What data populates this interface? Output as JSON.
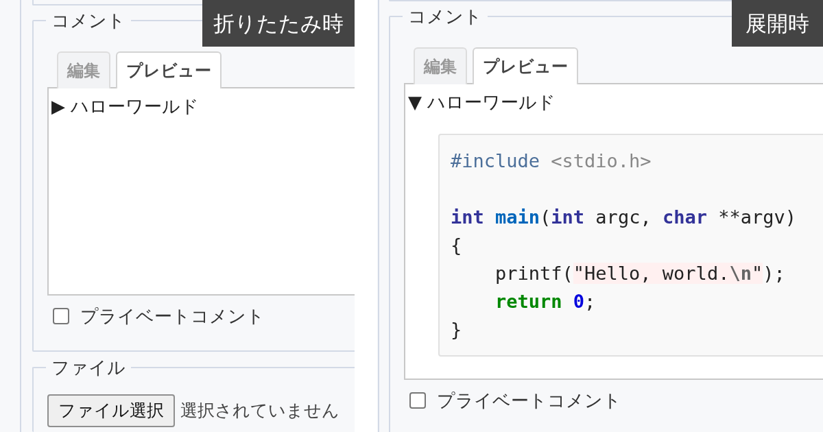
{
  "panels": [
    {
      "badge": "折りたたみ時",
      "legend": "コメント",
      "tabs": [
        {
          "label": "編集",
          "selected": false
        },
        {
          "label": "プレビュー",
          "selected": true
        }
      ],
      "details": {
        "expanded": false,
        "marker": "▶",
        "summary": "ハローワールド"
      },
      "checkbox": {
        "label": "プライベートコメント",
        "checked": false
      },
      "file_section": {
        "legend": "ファイル",
        "button": "ファイル選択",
        "status": "選択されていません"
      }
    },
    {
      "badge": "展開時",
      "legend": "コメント",
      "tabs": [
        {
          "label": "編集",
          "selected": false
        },
        {
          "label": "プレビュー",
          "selected": true
        }
      ],
      "details": {
        "expanded": true,
        "marker": "▼",
        "summary": "ハローワールド",
        "code": [
          {
            "kind": "code",
            "tokens": [
              {
                "text": "#include",
                "kind": "preproc"
              },
              {
                "text": " <stdio.h>",
                "kind": "header"
              }
            ]
          },
          {
            "kind": "blank"
          },
          {
            "kind": "code",
            "tokens": [
              {
                "text": "int",
                "kind": "keyword"
              },
              {
                "text": " main",
                "kind": "func"
              },
              {
                "text": "(",
                "kind": "plain"
              },
              {
                "text": "int",
                "kind": "keyword"
              },
              {
                "text": " argc, ",
                "kind": "plain"
              },
              {
                "text": "char",
                "kind": "keyword"
              },
              {
                "text": " **argv)",
                "kind": "plain"
              }
            ]
          },
          {
            "kind": "code",
            "tokens": [
              {
                "text": "{",
                "kind": "plain"
              }
            ]
          },
          {
            "kind": "code",
            "tokens": [
              {
                "text": "    printf(",
                "kind": "plain"
              },
              {
                "text": "\"Hello, world.",
                "kind": "string"
              },
              {
                "text": "\\n",
                "kind": "escape"
              },
              {
                "text": "\"",
                "kind": "string"
              },
              {
                "text": ");",
                "kind": "plain"
              }
            ]
          },
          {
            "kind": "code",
            "tokens": [
              {
                "text": "    return",
                "kind": "return"
              },
              {
                "text": " 0",
                "kind": "number"
              },
              {
                "text": ";",
                "kind": "plain"
              }
            ]
          },
          {
            "kind": "code",
            "tokens": [
              {
                "text": "}",
                "kind": "plain"
              }
            ]
          }
        ]
      },
      "checkbox": {
        "label": "プライベートコメント",
        "checked": false
      }
    }
  ]
}
